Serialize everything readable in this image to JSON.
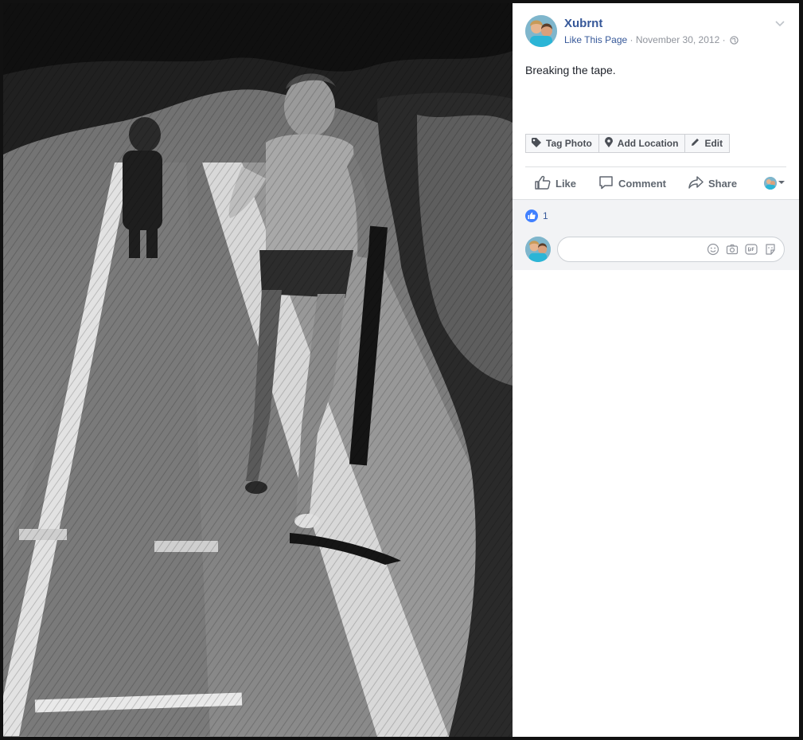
{
  "post": {
    "author": "Xubrnt",
    "like_page": "Like This Page",
    "separator": " · ",
    "date": "November 30, 2012",
    "caption": "Breaking the tape."
  },
  "photo_tools": {
    "tag_photo": "Tag Photo",
    "add_location": "Add Location",
    "edit": "Edit"
  },
  "actions": {
    "like": "Like",
    "comment": "Comment",
    "share": "Share"
  },
  "reactions": {
    "count": "1"
  },
  "comment_box": {
    "placeholder": ""
  },
  "icons": {
    "privacy": "globe-icon",
    "menu": "chevron-down-icon",
    "tag": "tag-icon",
    "location": "location-pin-icon",
    "edit": "pencil-icon",
    "like": "thumbs-up-icon",
    "comment": "speech-bubble-icon",
    "share": "share-arrow-icon",
    "emoji": "smiley-icon",
    "camera": "camera-icon",
    "gif": "gif-icon",
    "sticker": "sticker-icon"
  },
  "colors": {
    "link": "#365899",
    "like_blue": "#4080ff",
    "muted": "#90949c"
  }
}
